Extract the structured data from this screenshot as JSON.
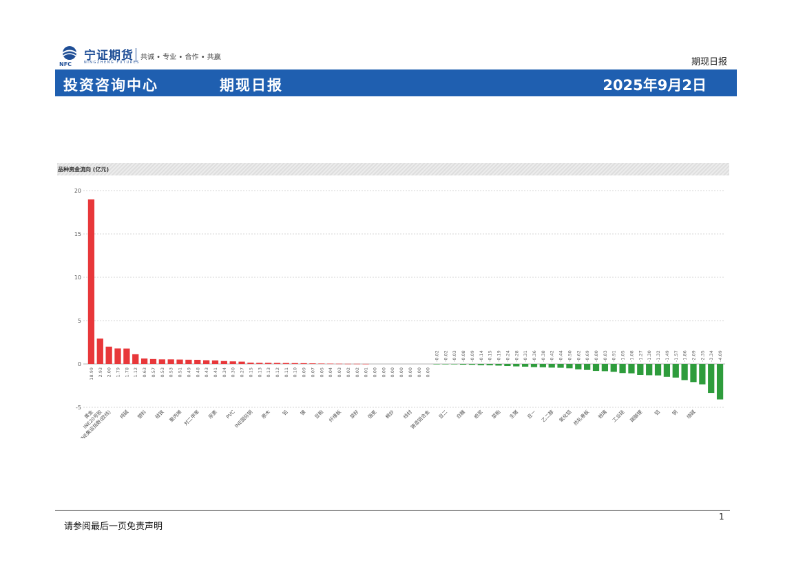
{
  "header": {
    "logo_cn": "宁证期货",
    "logo_en": "NINGZHENG FUTURES",
    "logo_mark": "NFC",
    "slogan": "共诚 • 专业 • 合作 • 共赢",
    "report_type": "期现日报"
  },
  "banner": {
    "dept": "投资咨询中心",
    "title": "期现日报",
    "date": "2025年9月2日"
  },
  "chart_data": {
    "type": "bar",
    "title": "品种资金流向 (亿元)",
    "yticks": [
      "20",
      "15",
      "10",
      "5",
      "0",
      "-5"
    ],
    "ylim": [
      -5,
      20
    ],
    "grid": true,
    "positive_color": "#e8373a",
    "negative_color": "#2e9c3c",
    "categories": [
      "黄金",
      "INE20号胶",
      "INE集运指数(欧线)",
      "",
      "纯碱",
      "",
      "塑料",
      "",
      "硅铁",
      "",
      "聚丙烯",
      "",
      "对二甲苯",
      "",
      "尿素",
      "",
      "PVC",
      "",
      "INE国际铜",
      "",
      "原木",
      "",
      "铅",
      "",
      "镍",
      "",
      "豆粕",
      "",
      "纤维板",
      "",
      "菜籽",
      "",
      "强麦",
      "",
      "棉纱",
      "",
      "线材",
      "",
      "铸造铝合金",
      "",
      "豆二",
      "",
      "白糖",
      "",
      "纸浆",
      "",
      "菜粕",
      "",
      "生猪",
      "",
      "豆一",
      "",
      "乙二醇",
      "",
      "氧化铝",
      "",
      "热轧卷板",
      "",
      "玻璃",
      "",
      "工业硅",
      "",
      "碳酸锂",
      "",
      "铝",
      "",
      "铜",
      "",
      "烧碱"
    ],
    "values": [
      18.99,
      2.93,
      2.0,
      1.79,
      1.78,
      1.12,
      0.63,
      0.57,
      0.53,
      0.53,
      0.51,
      0.49,
      0.48,
      0.43,
      0.41,
      0.34,
      0.3,
      0.27,
      0.15,
      0.13,
      0.13,
      0.12,
      0.11,
      0.1,
      0.09,
      0.07,
      0.05,
      0.04,
      0.03,
      0.02,
      0.02,
      0.01,
      0.0,
      0.0,
      0.0,
      0.0,
      0.0,
      0.0,
      0.0,
      -0.02,
      -0.02,
      -0.03,
      -0.08,
      -0.09,
      -0.14,
      -0.15,
      -0.19,
      -0.24,
      -0.28,
      -0.31,
      -0.36,
      -0.38,
      -0.42,
      -0.44,
      -0.5,
      -0.62,
      -0.69,
      -0.8,
      -0.83,
      -0.91,
      -1.05,
      -1.08,
      -1.27,
      -1.3,
      -1.32,
      -1.49,
      -1.57,
      -1.86,
      -2.09,
      -2.35,
      -3.34,
      -4.09
    ],
    "labels": [
      "18.99",
      "2.93",
      "2.00",
      "1.79",
      "1.78",
      "1.12",
      "0.63",
      "0.57",
      "0.53",
      "0.53",
      "0.51",
      "0.49",
      "0.48",
      "0.43",
      "0.41",
      "0.34",
      "0.30",
      "0.27",
      "0.15",
      "0.13",
      "0.13",
      "0.12",
      "0.11",
      "0.10",
      "0.09",
      "0.07",
      "0.05",
      "0.04",
      "0.03",
      "0.02",
      "0.02",
      "0.01",
      "0.00",
      "0.00",
      "0.00",
      "0.00",
      "0.00",
      "0.00",
      "0.00",
      "-0.02",
      "-0.02",
      "-0.03",
      "-0.08",
      "-0.09",
      "-0.14",
      "-0.15",
      "-0.19",
      "-0.24",
      "-0.28",
      "-0.31",
      "-0.36",
      "-0.38",
      "-0.42",
      "-0.44",
      "-0.50",
      "-0.62",
      "-0.69",
      "-0.80",
      "-0.83",
      "-0.91",
      "-1.05",
      "-1.08",
      "-1.27",
      "-1.30",
      "-1.32",
      "-1.49",
      "-1.57",
      "-1.86",
      "-2.09",
      "-2.35",
      "-3.34",
      "-4.09"
    ]
  },
  "footer": {
    "disclaimer": "请参阅最后一页免责声明",
    "page": "1"
  }
}
